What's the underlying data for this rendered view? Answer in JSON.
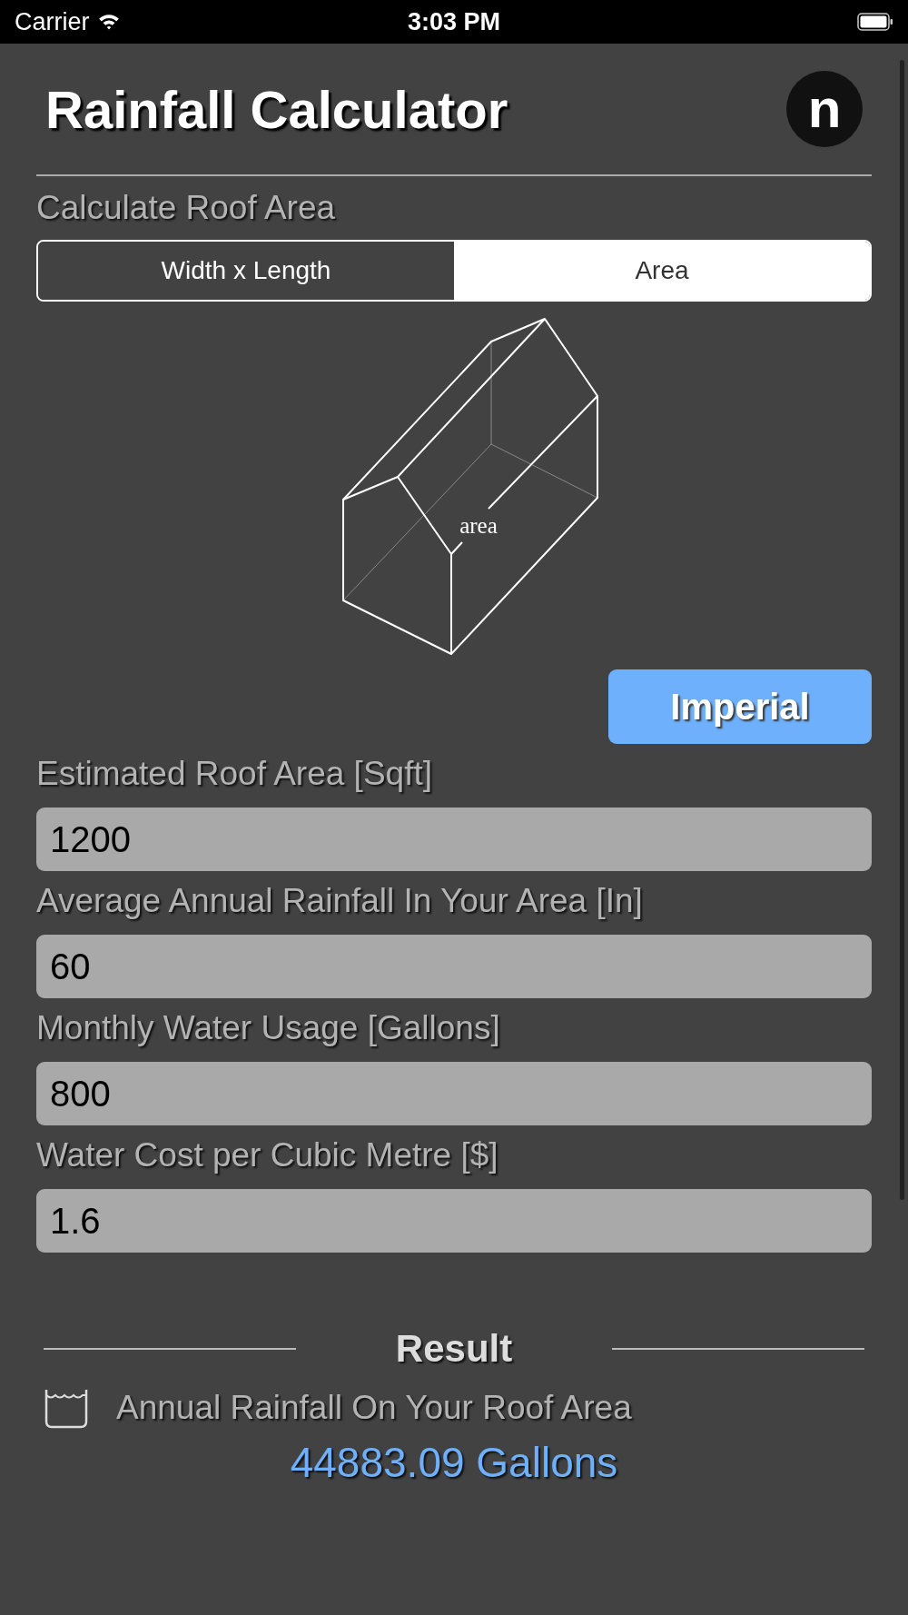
{
  "status_bar": {
    "carrier": "Carrier",
    "time": "3:03 PM"
  },
  "header": {
    "title": "Rainfall Calculator",
    "logo": "n"
  },
  "roof_section": {
    "label": "Calculate Roof Area",
    "segments": [
      {
        "label": "Width x Length",
        "selected": false
      },
      {
        "label": "Area",
        "selected": true
      }
    ],
    "diagram": {
      "label": "area"
    }
  },
  "unit_button": "Imperial",
  "fields": [
    {
      "label": "Estimated Roof Area [Sqft]",
      "value": "1200"
    },
    {
      "label": "Average Annual Rainfall In Your Area [In]",
      "value": "60"
    },
    {
      "label": "Monthly Water Usage [Gallons]",
      "value": "800"
    },
    {
      "label": "Water Cost per Cubic Metre [$]",
      "value": "1.6"
    }
  ],
  "result": {
    "heading": "Result",
    "items": [
      {
        "label": "Annual Rainfall On Your Roof Area",
        "value": "44883.09 Gallons"
      }
    ]
  }
}
